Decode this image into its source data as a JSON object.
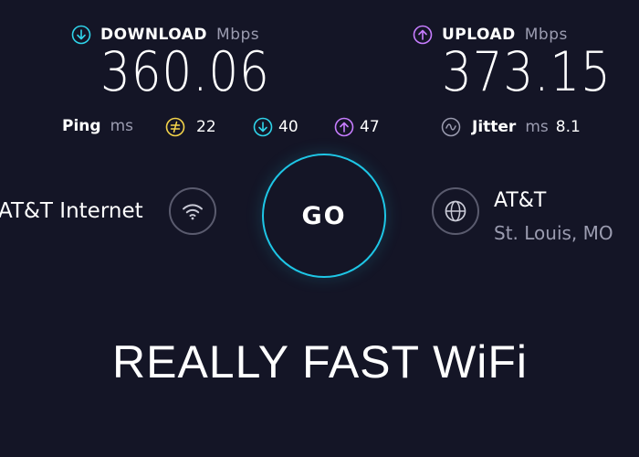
{
  "download": {
    "label": "DOWNLOAD",
    "unit": "Mbps",
    "value": "360.06",
    "icon": "arrow-down-circle-icon",
    "color": "#2fd4ea"
  },
  "upload": {
    "label": "UPLOAD",
    "unit": "Mbps",
    "value": "373.15",
    "icon": "arrow-up-circle-icon",
    "color": "#c77dff"
  },
  "ping": {
    "label": "Ping",
    "unit": "ms",
    "idle_value": "22",
    "download_value": "40",
    "upload_value": "47",
    "idle_color": "#f3d34a"
  },
  "jitter": {
    "label": "Jitter",
    "unit": "ms",
    "value": "8.1"
  },
  "provider": {
    "name": "AT&T Internet",
    "icon": "wifi-icon"
  },
  "go_button": {
    "label": "GO",
    "color": "#1ec6e6"
  },
  "server": {
    "name": "AT&T",
    "location": "St. Louis, MO",
    "icon": "globe-icon"
  },
  "caption": "REALLY FAST WiFi"
}
